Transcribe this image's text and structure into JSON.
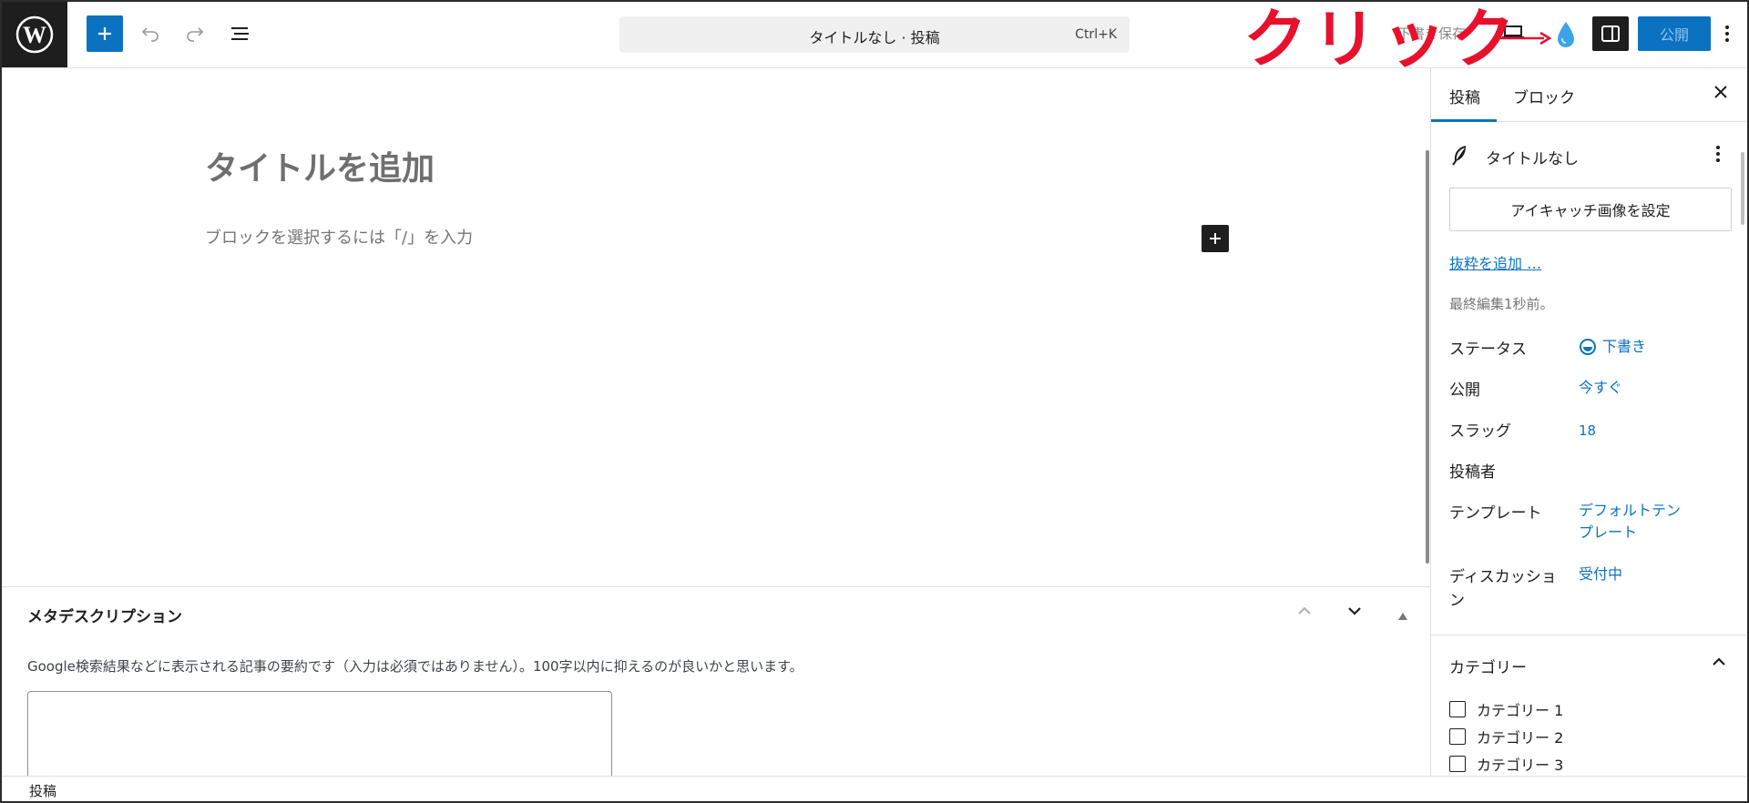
{
  "toolbar": {
    "document_title": "タイトルなし · 投稿",
    "shortcut": "Ctrl+K",
    "save_draft": "下書き保存",
    "publish": "公開"
  },
  "annotation": {
    "text": "クリック",
    "color": "#e8112d"
  },
  "editor": {
    "title_placeholder": "タイトルを追加",
    "block_placeholder": "ブロックを選択するには「/」を入力"
  },
  "metabox": {
    "title": "メタデスクリプション",
    "description": "Google検索結果などに表示される記事の要約です（入力は必須ではありません）。100字以内に抑えるのが良いかと思います。",
    "value": ""
  },
  "footer": {
    "breadcrumb": "投稿"
  },
  "sidebar": {
    "tabs": [
      "投稿",
      "ブロック"
    ],
    "active_tab": "投稿",
    "post_title": "タイトルなし",
    "featured_image_button": "アイキャッチ画像を設定",
    "excerpt_link": "抜粋を追加 …",
    "last_edited": "最終編集1秒前。",
    "rows": [
      {
        "label": "ステータス",
        "value": "下書き"
      },
      {
        "label": "公開",
        "value": "今すぐ"
      },
      {
        "label": "スラッグ",
        "value": "18"
      },
      {
        "label": "投稿者",
        "value": ""
      },
      {
        "label": "テンプレート",
        "value": "デフォルトテンプレート"
      },
      {
        "label": "ディスカッション",
        "value": "受付中"
      }
    ],
    "categories": {
      "title": "カテゴリー",
      "items": [
        {
          "label": "カテゴリー 1",
          "checked": false
        },
        {
          "label": "カテゴリー 2",
          "checked": false
        },
        {
          "label": "カテゴリー 3",
          "checked": false
        }
      ]
    }
  },
  "colors": {
    "accent": "#0b72c1",
    "dark": "#1e1e1e"
  }
}
